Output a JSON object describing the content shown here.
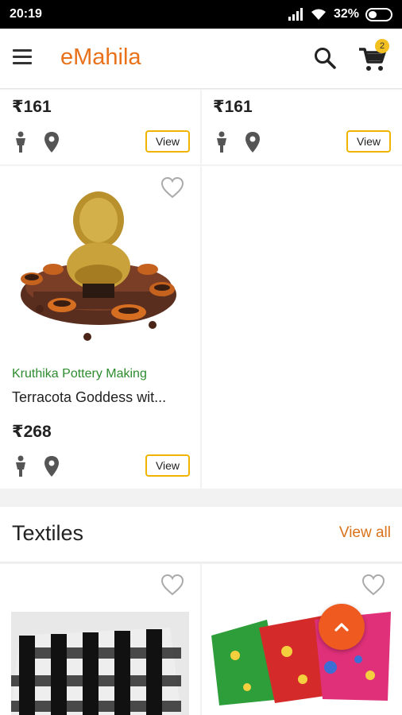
{
  "status_bar": {
    "time": "20:19",
    "battery": "32%"
  },
  "appbar": {
    "title": "eMahila",
    "cart_count": "2"
  },
  "top_row": [
    {
      "price": "₹161",
      "view_label": "View"
    },
    {
      "price": "₹161",
      "view_label": "View"
    }
  ],
  "product": {
    "seller": "Kruthika Pottery Making",
    "name": "Terracota Goddess wit...",
    "price": "₹268",
    "view_label": "View"
  },
  "section": {
    "title": "Textiles",
    "view_all": "View all"
  },
  "colors": {
    "accent": "#e8711a",
    "seller": "#2e8b2e",
    "view_border": "#f0b400",
    "fab": "#ef5a20"
  },
  "icons": [
    "menu-icon",
    "search-icon",
    "cart-icon",
    "person-icon",
    "location-icon",
    "heart-icon",
    "chevron-up-icon"
  ]
}
